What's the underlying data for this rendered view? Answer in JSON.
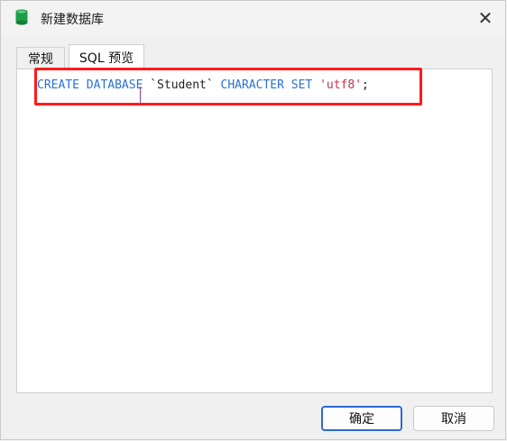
{
  "window": {
    "title": "新建数据库",
    "close_glyph": "✕",
    "icon": "database-icon",
    "icon_color": "#1e9e4a"
  },
  "tabs": [
    {
      "label": "常规",
      "active": false
    },
    {
      "label": "SQL 预览",
      "active": true
    }
  ],
  "sql_preview": {
    "kw1": "CREATE DATABASE",
    "name": " `Student` ",
    "kw2": "CHARACTER SET",
    "value": " 'utf8'",
    "end": ";"
  },
  "highlight_color": "#ff1a1a",
  "buttons": {
    "ok_label": "确定",
    "cancel_label": "取消"
  }
}
